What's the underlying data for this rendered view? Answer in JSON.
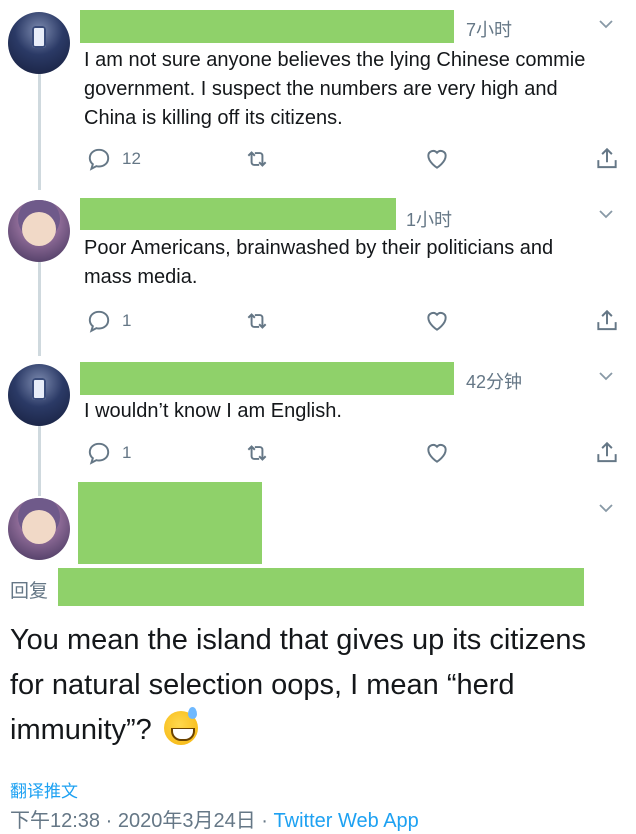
{
  "colors": {
    "redaction": "#8fd16a",
    "text": "#14171a",
    "muted": "#657786",
    "link": "#1da1f2",
    "thread_line": "#cfd9de"
  },
  "replies": [
    {
      "time": "7小时",
      "text": "I am not sure anyone believes the lying Chinese commie government. I suspect the numbers are very high and China is killing off its citizens.",
      "reply_count": "12",
      "icons": [
        "reply-icon",
        "retweet-icon",
        "like-icon",
        "share-icon"
      ]
    },
    {
      "time": "1小时",
      "text": "Poor Americans, brainwashed by their politicians and mass media.",
      "reply_count": "1"
    },
    {
      "time": "42分钟",
      "text": "I wouldn’t know I am English.",
      "reply_count": "1"
    }
  ],
  "main_tweet": {
    "reply_label": "回复",
    "text": "You mean the island that gives up its citizens for natural selection oops, I mean “herd immunity”?",
    "emoji": "sweat-smile-emoji",
    "translate_label": "翻译推文",
    "time": "下午12:38",
    "separator": "·",
    "date": "2020年3月24日",
    "app": "Twitter Web App"
  }
}
